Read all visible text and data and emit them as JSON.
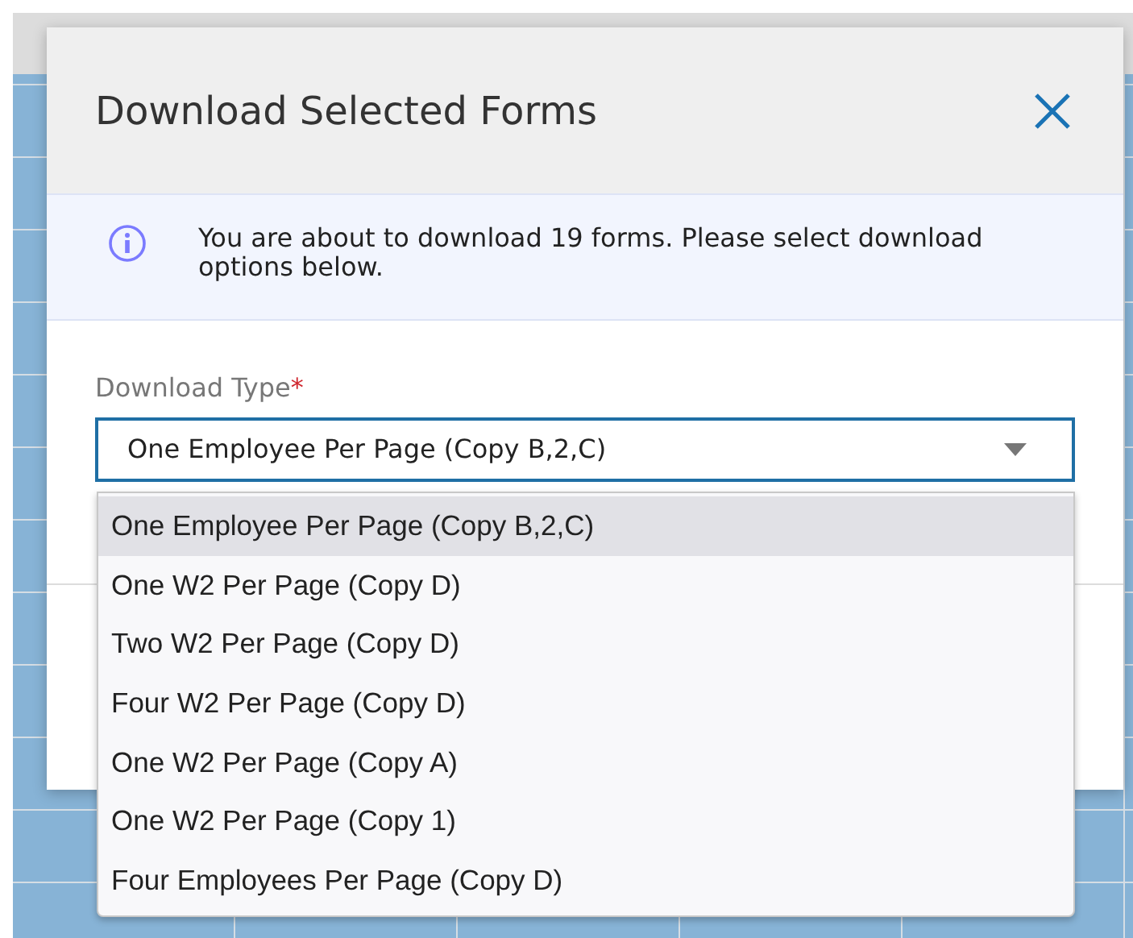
{
  "dialog": {
    "title": "Download Selected Forms",
    "info": {
      "text": "You are about to download 19 forms. Please select download options below."
    },
    "download_type": {
      "label": "Download Type",
      "required_mark": "*",
      "value": "One Employee Per Page (Copy B,2,C)",
      "expanded": true,
      "options": [
        {
          "label": "One Employee Per Page (Copy B,2,C)",
          "selected": true
        },
        {
          "label": "One W2 Per Page (Copy D)",
          "selected": false
        },
        {
          "label": "Two W2 Per Page (Copy D)",
          "selected": false
        },
        {
          "label": "Four W2 Per Page (Copy D)",
          "selected": false
        },
        {
          "label": "One W2 Per Page (Copy A)",
          "selected": false
        },
        {
          "label": "One W2 Per Page (Copy 1)",
          "selected": false
        },
        {
          "label": "Four Employees Per Page (Copy D)",
          "selected": false
        }
      ]
    }
  }
}
